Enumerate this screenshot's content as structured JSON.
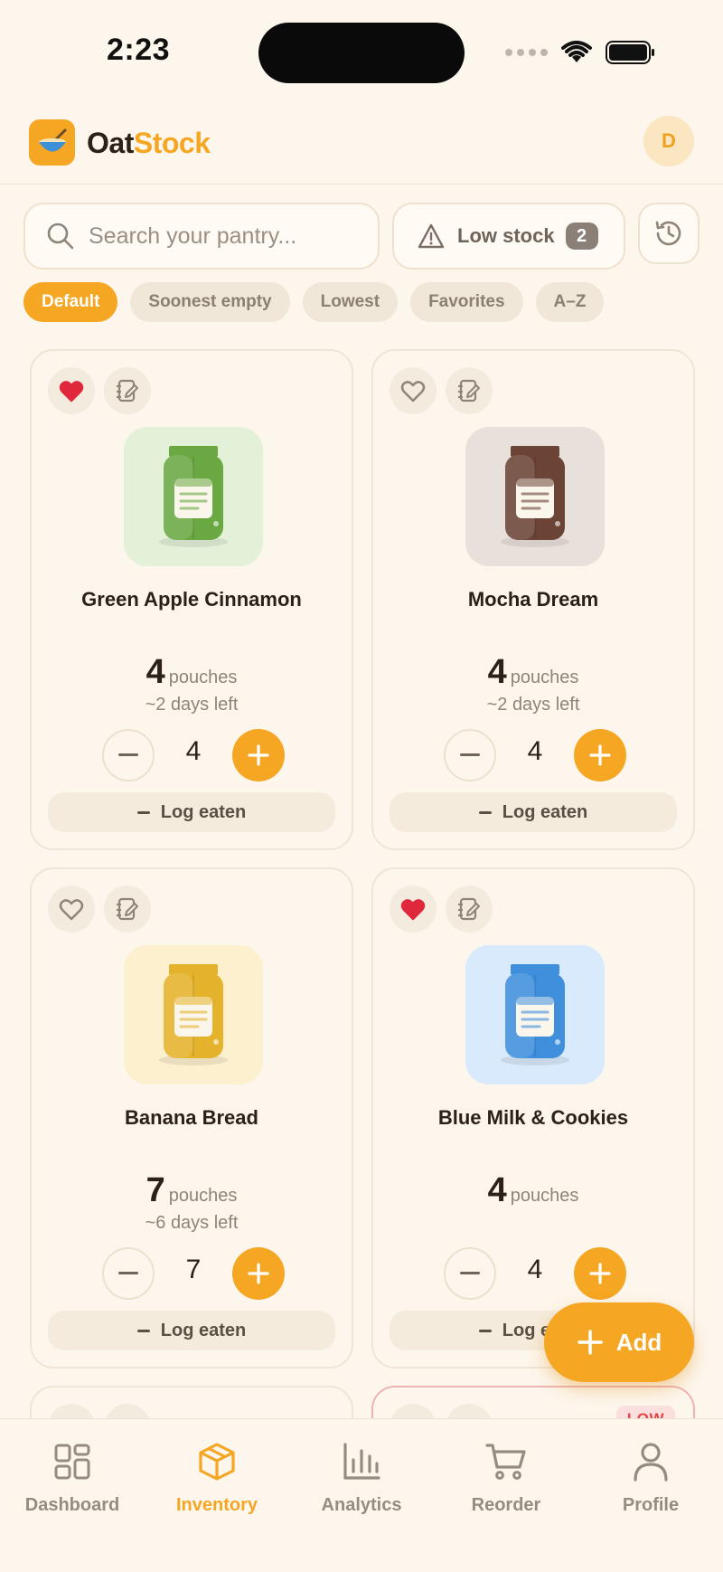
{
  "status_bar": {
    "time": "2:23"
  },
  "header": {
    "brand_part1": "Oat",
    "brand_part2": "Stock",
    "avatar_initial": "D"
  },
  "search": {
    "placeholder": "Search your pantry..."
  },
  "low_stock": {
    "label": "Low stock",
    "count": "2"
  },
  "sort_chips": [
    {
      "label": "Default",
      "active": true
    },
    {
      "label": "Soonest empty",
      "active": false
    },
    {
      "label": "Lowest",
      "active": false
    },
    {
      "label": "Favorites",
      "active": false
    },
    {
      "label": "A–Z",
      "active": false
    }
  ],
  "products": [
    {
      "name": "Green Apple Cinnamon",
      "qty": "4",
      "unit": "pouches",
      "days_left": "~2 days left",
      "stepper_value": "4",
      "favorite": true,
      "jar_color": "#6aa842",
      "bg_color": "#e3f1d8",
      "log_label": "Log eaten"
    },
    {
      "name": "Mocha Dream",
      "qty": "4",
      "unit": "pouches",
      "days_left": "~2 days left",
      "stepper_value": "4",
      "favorite": false,
      "jar_color": "#6b4436",
      "bg_color": "#e8e0db",
      "log_label": "Log eaten"
    },
    {
      "name": "Banana Bread",
      "qty": "7",
      "unit": "pouches",
      "days_left": "~6 days left",
      "stepper_value": "7",
      "favorite": false,
      "jar_color": "#e5b22c",
      "bg_color": "#fdf0cf",
      "log_label": "Log eaten"
    },
    {
      "name": "Blue Milk & Cookies",
      "qty": "4",
      "unit": "pouches",
      "days_left": "",
      "stepper_value": "4",
      "favorite": true,
      "jar_color": "#3f8fdc",
      "bg_color": "#d8eafc",
      "log_label": "Log eaten"
    }
  ],
  "partial_cards": {
    "low_badge": "LOW"
  },
  "fab": {
    "label": "Add"
  },
  "bottom_nav": [
    {
      "label": "Dashboard",
      "icon": "grid-icon",
      "active": false
    },
    {
      "label": "Inventory",
      "icon": "box-icon",
      "active": true
    },
    {
      "label": "Analytics",
      "icon": "bar-chart-icon",
      "active": false
    },
    {
      "label": "Reorder",
      "icon": "cart-icon",
      "active": false
    },
    {
      "label": "Profile",
      "icon": "user-icon",
      "active": false
    }
  ],
  "colors": {
    "accent": "#f5a623",
    "background": "#fdf6ec",
    "favorite": "#e0283c",
    "low": "#e04848"
  }
}
